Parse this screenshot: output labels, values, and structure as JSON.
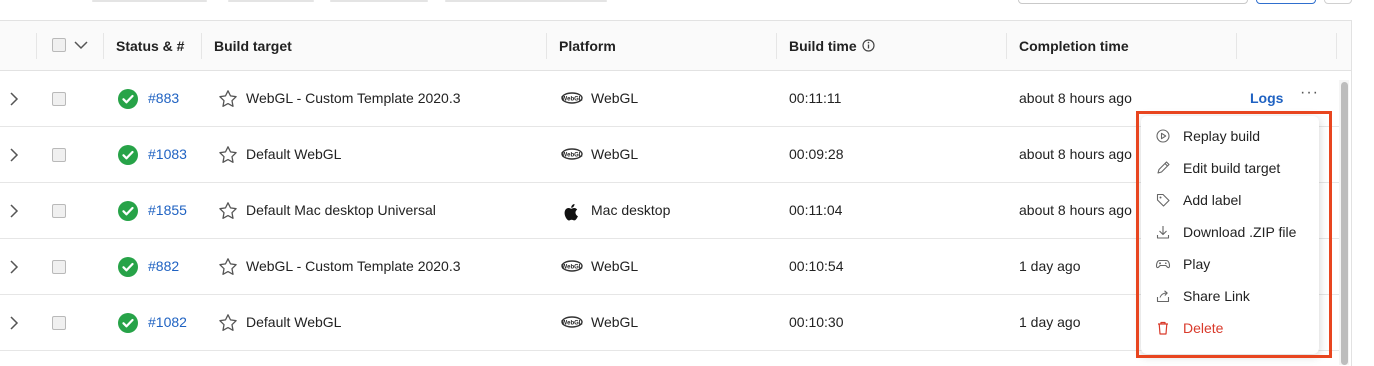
{
  "table": {
    "columns": {
      "status": "Status & #",
      "build_target": "Build target",
      "platform": "Platform",
      "build_time": "Build time",
      "completion_time": "Completion time"
    },
    "rows": [
      {
        "number": "#883",
        "target": "WebGL - Custom Template 2020.3",
        "platform": "WebGL",
        "platform_icon": "webgl-icon",
        "build_time": "00:11:11",
        "completion": "about 8 hours ago",
        "logs": "Logs"
      },
      {
        "number": "#1083",
        "target": "Default WebGL",
        "platform": "WebGL",
        "platform_icon": "webgl-icon",
        "build_time": "00:09:28",
        "completion": "about 8 hours ago"
      },
      {
        "number": "#1855",
        "target": "Default Mac desktop Universal",
        "platform": "Mac desktop",
        "platform_icon": "apple-icon",
        "build_time": "00:11:04",
        "completion": "about 8 hours ago"
      },
      {
        "number": "#882",
        "target": "WebGL - Custom Template 2020.3",
        "platform": "WebGL",
        "platform_icon": "webgl-icon",
        "build_time": "00:10:54",
        "completion": "1 day ago"
      },
      {
        "number": "#1082",
        "target": "Default WebGL",
        "platform": "WebGL",
        "platform_icon": "webgl-icon",
        "build_time": "00:10:30",
        "completion": "1 day ago"
      }
    ]
  },
  "menu": {
    "items": [
      {
        "label": "Replay build",
        "icon": "replay-icon"
      },
      {
        "label": "Edit build target",
        "icon": "pencil-icon"
      },
      {
        "label": "Add label",
        "icon": "tag-icon"
      },
      {
        "label": "Download .ZIP file",
        "icon": "download-icon"
      },
      {
        "label": "Play",
        "icon": "gamepad-icon"
      },
      {
        "label": "Share Link",
        "icon": "share-icon"
      },
      {
        "label": "Delete",
        "icon": "trash-icon",
        "danger": true
      }
    ]
  },
  "colors": {
    "accent": "#1f62c2",
    "success": "#27a348",
    "danger": "#d93a2b",
    "highlight": "#e8451f"
  }
}
